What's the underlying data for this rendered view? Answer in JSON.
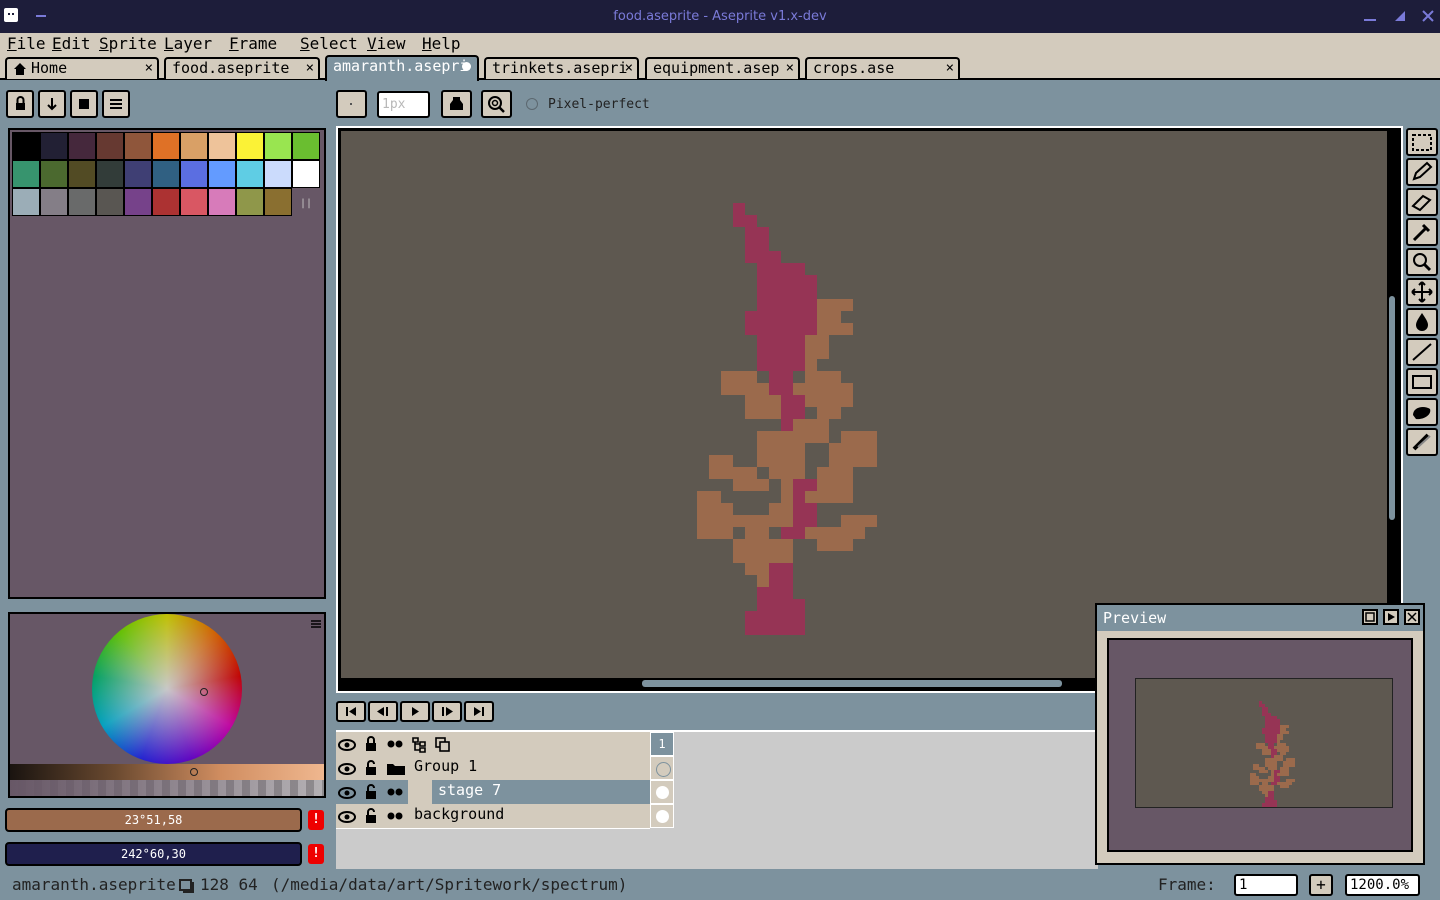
{
  "window": {
    "title": "food.aseprite - Aseprite v1.x-dev",
    "controls": [
      "minimize-icon",
      "maximize-icon",
      "close-icon"
    ]
  },
  "menu": [
    {
      "label": "File",
      "accel": "F",
      "rest": "ile"
    },
    {
      "label": "Edit",
      "accel": "E",
      "rest": "dit"
    },
    {
      "label": "Sprite",
      "accel": "S",
      "rest": "prite"
    },
    {
      "label": "Layer",
      "accel": "L",
      "rest": "ayer"
    },
    {
      "label": "Frame",
      "accel": "F",
      "rest": "rame"
    },
    {
      "label": "Select",
      "accel": "S",
      "rest": "elect"
    },
    {
      "label": "View",
      "accel": "V",
      "rest": "iew"
    },
    {
      "label": "Help",
      "accel": "H",
      "rest": "elp"
    }
  ],
  "tabs": [
    {
      "label": "Home",
      "icon": "home-icon",
      "close": "×"
    },
    {
      "label": "food.aseprite",
      "close": "×"
    },
    {
      "label": "amaranth.asepri",
      "active": true,
      "modified": true
    },
    {
      "label": "trinkets.asepri",
      "close": "×"
    },
    {
      "label": "equipment.asep",
      "close": "×"
    },
    {
      "label": "crops.ase",
      "close": "×"
    }
  ],
  "toolbar": {
    "brush_size": "1px",
    "pixel_perfect_label": "Pixel-perfect",
    "pixel_perfect_checked": false
  },
  "palette": {
    "colors": [
      "#000000",
      "#222034",
      "#45283c",
      "#663931",
      "#8f563b",
      "#df7126",
      "#d9a066",
      "#eec39a",
      "#fbf236",
      "#99e550",
      "#6abe30",
      "#37946e",
      "#4b692f",
      "#524b24",
      "#323c39",
      "#3f3f74",
      "#306082",
      "#5b6ee1",
      "#639bff",
      "#5fcde4",
      "#cbdbfc",
      "#ffffff",
      "#9badb7",
      "#847e87",
      "#696a6a",
      "#595652",
      "#76428a",
      "#ac3232",
      "#d95763",
      "#d77bba",
      "#8f974a",
      "#8a6f30"
    ]
  },
  "colors": {
    "foreground_label": "23°51,58",
    "foreground_hex": "#9b6a4c",
    "background_label": "242°60,30",
    "background_hex": "#1f1f4d",
    "warning_glyph": "!"
  },
  "playback": {
    "buttons": [
      "first-frame-icon",
      "previous-frame-icon",
      "play-icon",
      "next-frame-icon",
      "last-frame-icon"
    ]
  },
  "timeline": {
    "frame_header": "1",
    "layers": [
      {
        "name": "Group 1",
        "type": "group",
        "indent": false,
        "cel": "empty"
      },
      {
        "name": "stage 7",
        "type": "layer",
        "indent": true,
        "selected": true,
        "cel": "filled"
      },
      {
        "name": "background",
        "type": "layer",
        "indent": false,
        "cel": "filled"
      }
    ]
  },
  "preview": {
    "title": "Preview"
  },
  "statusbar": {
    "filename": "amaranth.aseprite",
    "size": "128 64",
    "path": "(/media/data/art/Spritework/spectrum)",
    "frame_label": "Frame:",
    "frame_value": "1",
    "add_frame": "+",
    "zoom": "1200.0%"
  },
  "tools": [
    "marquee-icon",
    "pencil-icon",
    "eraser-icon",
    "eyedropper-icon",
    "zoom-icon",
    "move-icon",
    "paint-bucket-icon",
    "line-icon",
    "rectangle-icon",
    "contour-icon",
    "blur-icon"
  ],
  "sprite_colors": {
    "stem": "#963455",
    "leaf": "#9b6a4c"
  }
}
